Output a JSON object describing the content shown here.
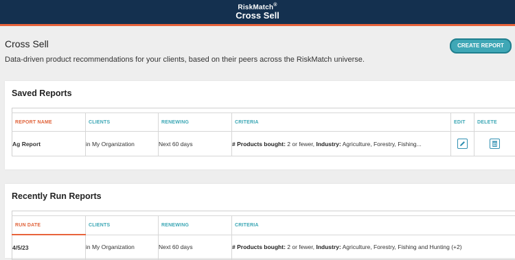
{
  "header": {
    "brand": "RiskMatch",
    "brand_mark": "®",
    "title": "Cross Sell"
  },
  "page": {
    "title": "Cross Sell",
    "subtitle": "Data-driven product recommendations for your clients, based on their peers across the RiskMatch universe.",
    "create_button": "CREATE REPORT"
  },
  "saved_reports": {
    "title": "Saved Reports",
    "columns": {
      "name": "REPORT NAME",
      "clients": "CLIENTS",
      "renewing": "RENEWING",
      "criteria": "CRITERIA",
      "edit": "EDIT",
      "delete": "DELETE"
    },
    "rows": [
      {
        "name": "Ag Report",
        "clients": "in My Organization",
        "renewing": "Next 60 days",
        "criteria_products_label": "# Products bought:",
        "criteria_products_value": "2 or fewer,",
        "criteria_industry_label": "Industry:",
        "criteria_industry_value": "Agriculture, Forestry, Fishing..."
      }
    ]
  },
  "recent_reports": {
    "title": "Recently Run Reports",
    "columns": {
      "run_date": "RUN DATE",
      "clients": "CLIENTS",
      "renewing": "RENEWING",
      "criteria": "CRITERIA"
    },
    "rows": [
      {
        "run_date": "4/5/23",
        "clients": "in My Organization",
        "renewing": "Next 60 days",
        "criteria_products_label": "# Products bought:",
        "criteria_products_value": "2 or fewer,",
        "criteria_industry_label": "Industry:",
        "criteria_industry_value": "Agriculture, Forestry, Fishing and Hunting (+2)"
      }
    ]
  },
  "colors": {
    "header_bg": "#14304f",
    "header_accent": "#e8633a",
    "teal": "#3fa7b6",
    "link": "#2f8fb1",
    "sort_header": "#e0633a"
  },
  "icons": {
    "edit": "pencil-icon",
    "delete": "trash-icon"
  }
}
